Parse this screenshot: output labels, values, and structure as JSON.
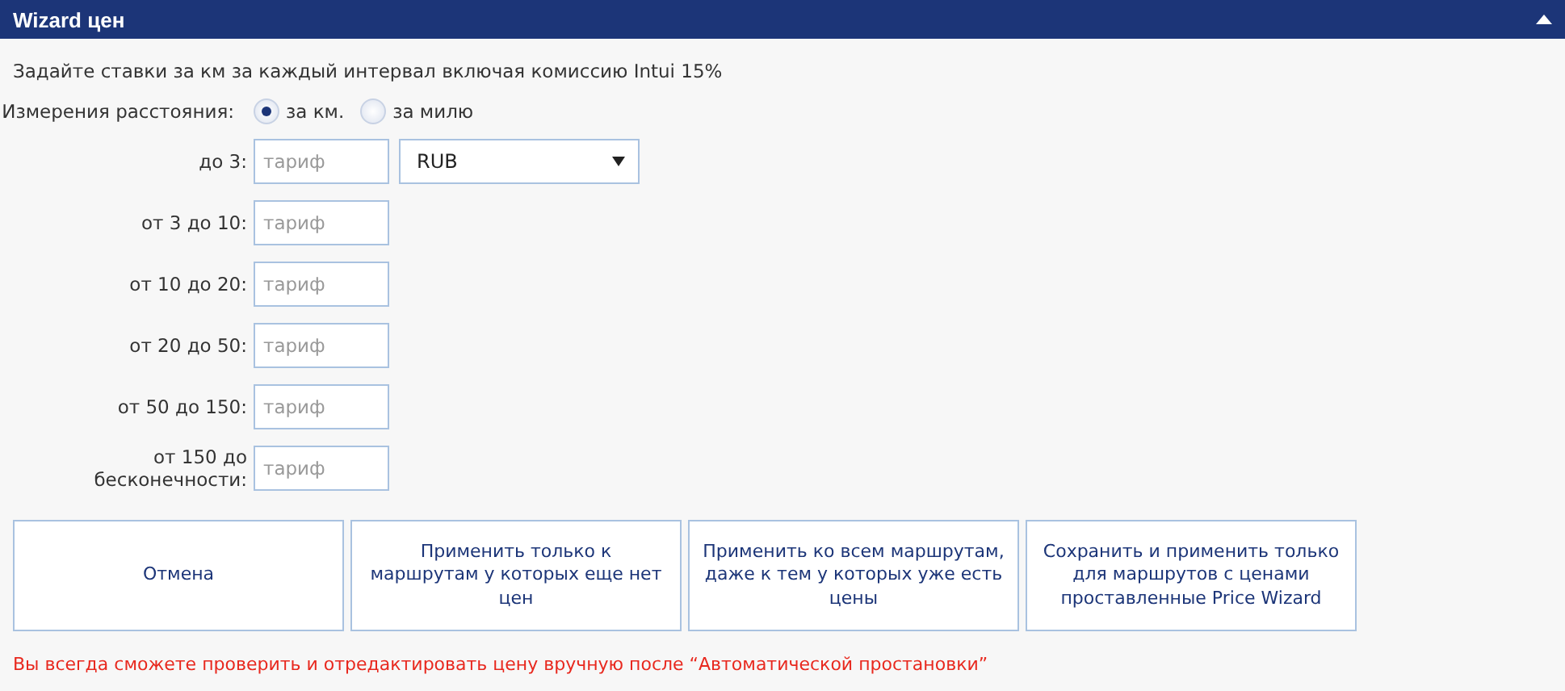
{
  "panel": {
    "title": "Wizard цен",
    "expanded": true
  },
  "intro": "Задайте ставки за км за каждый интервал включая комиссию Intui 15%",
  "distance": {
    "label": "Измерения расстояния:",
    "options": [
      {
        "label": "за км.",
        "selected": true
      },
      {
        "label": "за милю",
        "selected": false
      }
    ]
  },
  "intervals": [
    {
      "label": "до 3:",
      "placeholder": "тариф",
      "currency": "RUB"
    },
    {
      "label": "от 3 до 10:",
      "placeholder": "тариф"
    },
    {
      "label": "от 10 до 20:",
      "placeholder": "тариф"
    },
    {
      "label": "от 20 до 50:",
      "placeholder": "тариф"
    },
    {
      "label": "от 50 до 150:",
      "placeholder": "тариф"
    },
    {
      "label": "от 150 до бесконечности:",
      "placeholder": "тариф"
    }
  ],
  "buttons": [
    "Отмена",
    "Применить только к маршрутам у которых еще нет цен",
    "Применить ко всем маршрутам, даже к тем у которых уже есть цены",
    "Сохранить и применить только для маршрутов с ценами проставленные Price Wizard"
  ],
  "note": "Вы всегда сможете проверить и отредактировать цену вручную после “Автоматической простановки”"
}
